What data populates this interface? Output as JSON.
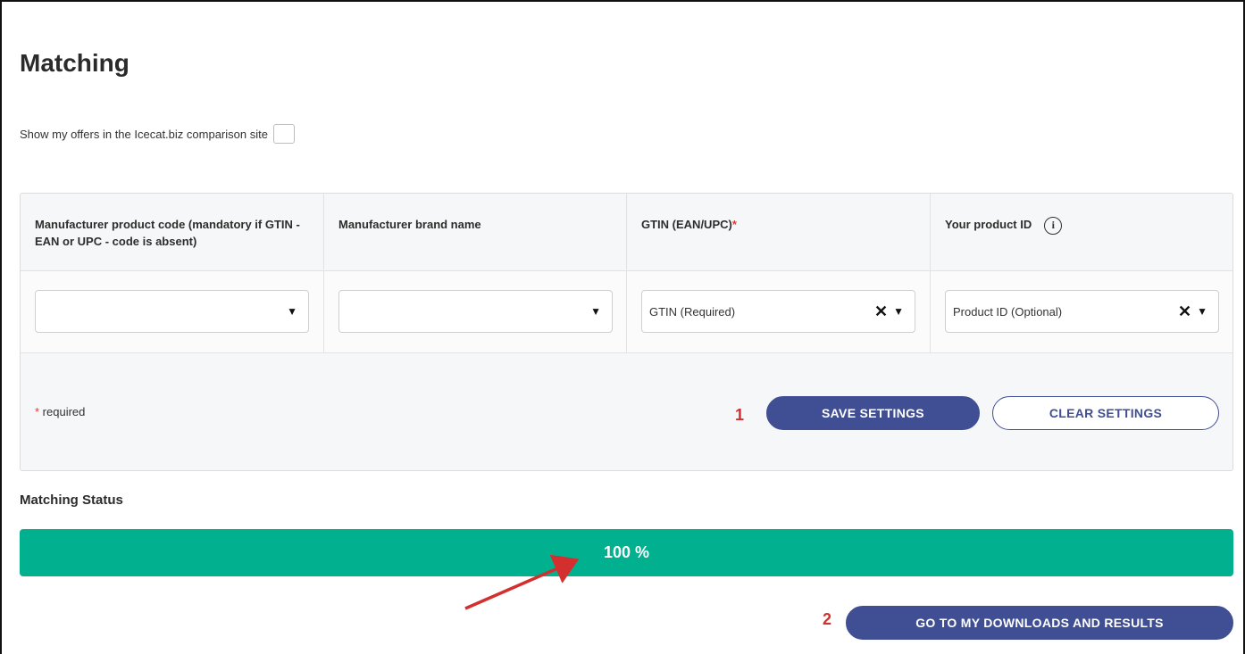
{
  "page": {
    "title": "Matching"
  },
  "offers": {
    "label": "Show my offers in the Icecat.biz comparison site",
    "checked": false
  },
  "columns": [
    {
      "header": "Manufacturer product code (mandatory if GTIN - EAN or UPC - code is absent)",
      "select_value": ""
    },
    {
      "header": "Manufacturer brand name",
      "select_value": ""
    },
    {
      "header": "GTIN (EAN/UPC)",
      "required_mark": "*",
      "select_value": "GTIN (Required)",
      "clear_icon": "✕-icon"
    },
    {
      "header": "Your product ID",
      "info_icon": "i",
      "select_value": "Product ID (Optional)",
      "clear_icon": "✕-icon"
    }
  ],
  "footer": {
    "required_mark": "*",
    "required_label": " required",
    "step1": "1",
    "save_label": "SAVE SETTINGS",
    "clear_label": "CLEAR SETTINGS"
  },
  "status": {
    "title": "Matching Status",
    "progress_text": "100 %",
    "progress_fraction": 1.0
  },
  "downloads": {
    "step2": "2",
    "label": "GO TO MY DOWNLOADS AND RESULTS"
  },
  "colors": {
    "accent": "#404f93",
    "progress": "#00b08f",
    "annotation": "#d32f2f"
  }
}
